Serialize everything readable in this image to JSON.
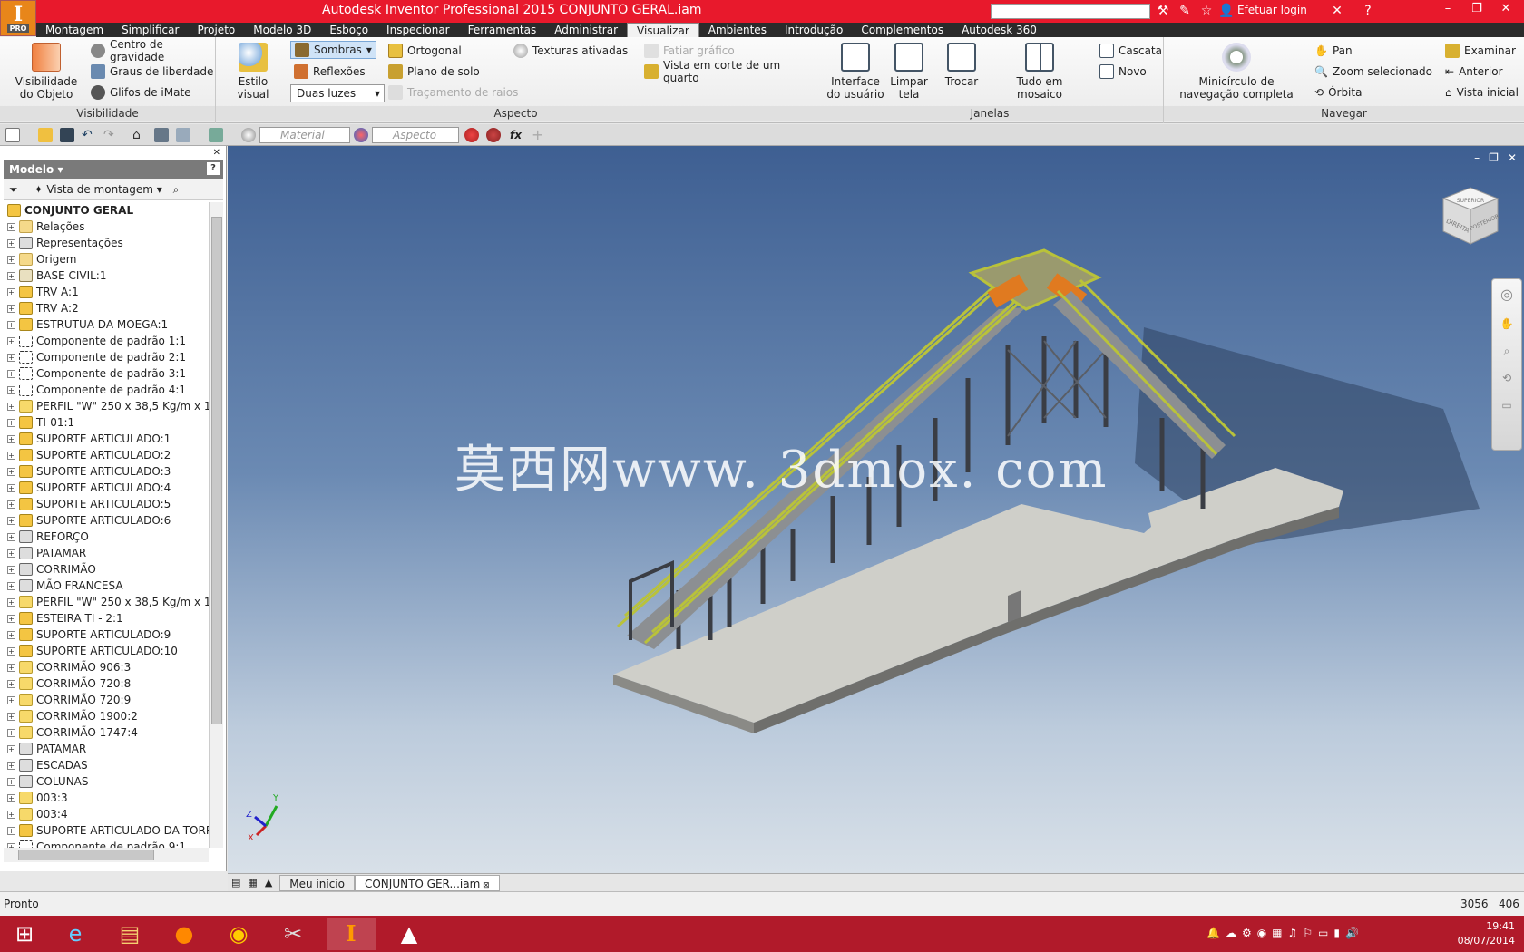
{
  "app": {
    "title": "Autodesk Inventor Professional 2015    CONJUNTO GERAL.iam",
    "logo_letter": "I",
    "logo_badge": "PRO",
    "login": "Efetuar login"
  },
  "tabs": [
    "Montagem",
    "Simplificar",
    "Projeto",
    "Modelo 3D",
    "Esboço",
    "Inspecionar",
    "Ferramentas",
    "Administrar",
    "Visualizar",
    "Ambientes",
    "Introdução",
    "Complementos",
    "Autodesk 360"
  ],
  "active_tab": "Visualizar",
  "ribbon": {
    "visibilidade": {
      "label": "Visibilidade",
      "big": "Visibilidade do Objeto",
      "items": [
        "Centro de gravidade",
        "Graus de liberdade",
        "Glifos de iMate"
      ]
    },
    "aspecto": {
      "label": "Aspecto",
      "estilo": "Estilo visual",
      "sombras": "Sombras",
      "reflexoes": "Reflexões",
      "luzes": "Duas luzes",
      "ortogonal": "Ortogonal",
      "plano": "Plano de solo",
      "tracamento": "Traçamento de raios",
      "texturas": "Texturas ativadas",
      "fatiar": "Fatiar gráfico",
      "vista_corte": "Vista em corte de um quarto"
    },
    "janelas": {
      "label": "Janelas",
      "interface": "Interface do usuário",
      "limpar": "Limpar tela",
      "trocar": "Trocar",
      "mosaico": "Tudo em mosaico",
      "cascata": "Cascata",
      "novo": "Novo"
    },
    "navegar": {
      "label": "Navegar",
      "minicirculo": "Minicírculo de navegação completa",
      "pan": "Pan",
      "zoom": "Zoom selecionado",
      "orbita": "Órbita",
      "examinar": "Examinar",
      "anterior": "Anterior",
      "vista_inicial": "Vista inicial"
    }
  },
  "qat": {
    "material_placeholder": "Material",
    "aspecto_placeholder": "Aspecto",
    "fx": "fx"
  },
  "browser": {
    "header": "Modelo",
    "view": "Vista de montagem",
    "root": "CONJUNTO GERAL",
    "nodes": [
      {
        "label": "Relações",
        "icon": "fold"
      },
      {
        "label": "Representações",
        "icon": "rep"
      },
      {
        "label": "Origem",
        "icon": "fold"
      },
      {
        "label": "BASE CIVIL:1",
        "icon": "civ"
      },
      {
        "label": "TRV A:1",
        "icon": "asm"
      },
      {
        "label": "TRV A:2",
        "icon": "asm"
      },
      {
        "label": "ESTRUTUA DA MOEGA:1",
        "icon": "asm"
      },
      {
        "label": "Componente de padrão 1:1",
        "icon": "pat"
      },
      {
        "label": "Componente de padrão 2:1",
        "icon": "pat"
      },
      {
        "label": "Componente de padrão 3:1",
        "icon": "pat"
      },
      {
        "label": "Componente de padrão 4:1",
        "icon": "pat"
      },
      {
        "label": "PERFIL \"W\" 250 x 38,5 Kg/m x 1",
        "icon": "prt"
      },
      {
        "label": "TI-01:1",
        "icon": "asm"
      },
      {
        "label": "SUPORTE ARTICULADO:1",
        "icon": "asm"
      },
      {
        "label": "SUPORTE ARTICULADO:2",
        "icon": "asm"
      },
      {
        "label": "SUPORTE ARTICULADO:3",
        "icon": "asm"
      },
      {
        "label": "SUPORTE ARTICULADO:4",
        "icon": "asm"
      },
      {
        "label": "SUPORTE ARTICULADO:5",
        "icon": "asm"
      },
      {
        "label": "SUPORTE ARTICULADO:6",
        "icon": "asm"
      },
      {
        "label": "REFORÇO",
        "icon": "rep"
      },
      {
        "label": "PATAMAR",
        "icon": "rep"
      },
      {
        "label": "CORRIMÃO",
        "icon": "rep"
      },
      {
        "label": "MÃO FRANCESA",
        "icon": "rep"
      },
      {
        "label": "PERFIL \"W\" 250 x 38,5 Kg/m x 1",
        "icon": "prt"
      },
      {
        "label": "ESTEIRA TI - 2:1",
        "icon": "asm"
      },
      {
        "label": "SUPORTE ARTICULADO:9",
        "icon": "asm"
      },
      {
        "label": "SUPORTE ARTICULADO:10",
        "icon": "asm"
      },
      {
        "label": "CORRIMÃO 906:3",
        "icon": "prt"
      },
      {
        "label": "CORRIMÃO 720:8",
        "icon": "prt"
      },
      {
        "label": "CORRIMÃO 720:9",
        "icon": "prt"
      },
      {
        "label": "CORRIMÃO 1900:2",
        "icon": "prt"
      },
      {
        "label": "CORRIMÃO 1747:4",
        "icon": "prt"
      },
      {
        "label": "PATAMAR",
        "icon": "rep"
      },
      {
        "label": "ESCADAS",
        "icon": "rep"
      },
      {
        "label": "COLUNAS",
        "icon": "rep"
      },
      {
        "label": "003:3",
        "icon": "prt"
      },
      {
        "label": "003:4",
        "icon": "prt"
      },
      {
        "label": "SUPORTE ARTICULADO DA TORR",
        "icon": "asm"
      },
      {
        "label": "Componente de padrão 9:1",
        "icon": "pat"
      }
    ]
  },
  "viewcube": {
    "face1": "DIREITA",
    "face2": "POSTERIOR",
    "top": "SUPERIOR"
  },
  "watermark": "莫西网www. 3dmox. com",
  "axes": {
    "x": "X",
    "y": "Y",
    "z": "Z"
  },
  "doc_tabs": [
    {
      "label": "Meu início",
      "active": false
    },
    {
      "label": "CONJUNTO GER...iam",
      "active": true
    }
  ],
  "status": {
    "text": "Pronto",
    "n1": "3056",
    "n2": "406"
  },
  "clock": {
    "time": "19:41",
    "date": "08/07/2014"
  },
  "colors": {
    "titlebar": "#e8192c",
    "taskbar": "#b11a2a",
    "structure_rail": "#b9c23a",
    "hopper": "#e07a20"
  }
}
